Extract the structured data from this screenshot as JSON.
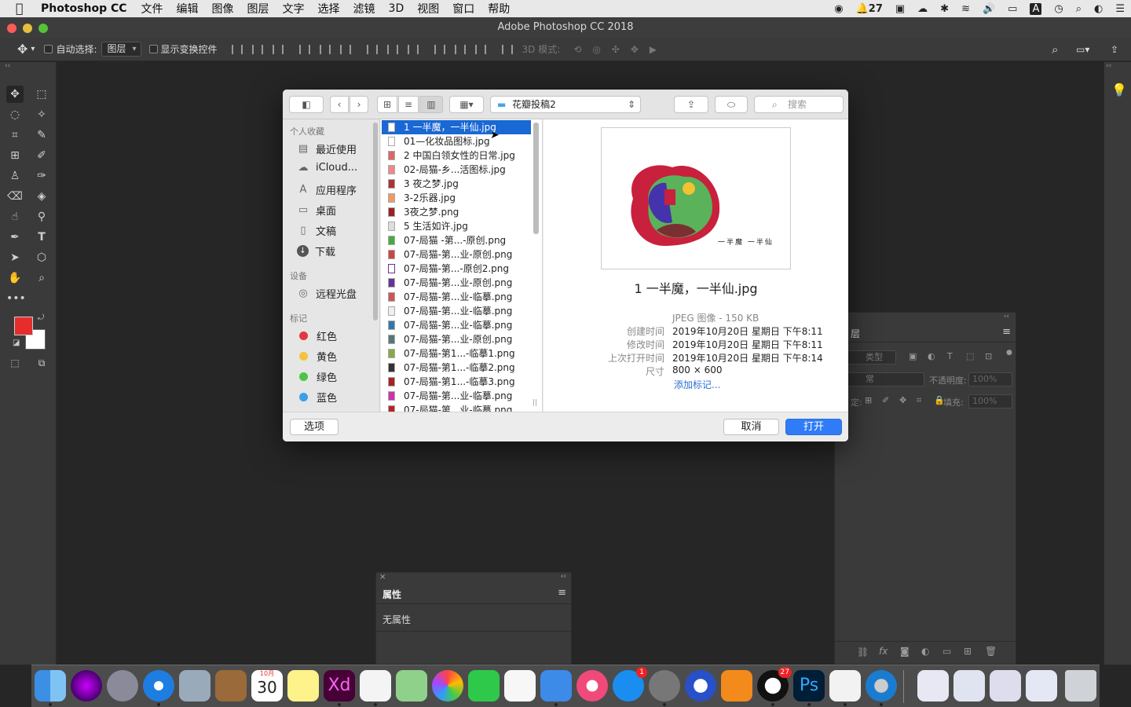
{
  "menubar": {
    "app_name": "Photoshop CC",
    "items": [
      "文件",
      "编辑",
      "图像",
      "图层",
      "文字",
      "选择",
      "滤镜",
      "3D",
      "视图",
      "窗口",
      "帮助"
    ],
    "notification_count": "27",
    "input_method": "A"
  },
  "window": {
    "title": "Adobe Photoshop CC 2018"
  },
  "options_bar": {
    "auto_select_label": "自动选择:",
    "auto_select_value": "图层",
    "show_transform_label": "显示变换控件",
    "mode_3d_label": "3D 模式:"
  },
  "dialog": {
    "location": "花瓣投稿2",
    "search_placeholder": "搜索",
    "sidebar": {
      "favorites_header": "个人收藏",
      "favorites": [
        "最近使用",
        "iCloud...",
        "应用程序",
        "桌面",
        "文稿",
        "下载"
      ],
      "devices_header": "设备",
      "devices": [
        "远程光盘"
      ],
      "tags_header": "标记",
      "tags": [
        {
          "label": "红色",
          "color": "#e3393b"
        },
        {
          "label": "黄色",
          "color": "#f3c33e"
        },
        {
          "label": "绿色",
          "color": "#4bc545"
        },
        {
          "label": "蓝色",
          "color": "#3b9ee8"
        }
      ]
    },
    "files": [
      "1 一半魔，一半仙.jpg",
      "01—化妆品图标.jpg",
      "2 中国白领女性的日常.jpg",
      "02-局猫-乡...活图标.jpg",
      "3 夜之梦.jpg",
      "3-2乐器.jpg",
      "3夜之梦.png",
      "5 生活如许.jpg",
      "07-局猫 -第...-原创.png",
      "07-局猫-第...业-原创.png",
      "07-局猫-第...-原创2.png",
      "07-局猫-第...业-原创.png",
      "07-局猫-第...业-临摹.png",
      "07-局猫-第...业-临摹.png",
      "07-局猫-第...业-临摹.png",
      "07-局猫-第...业-原创.png",
      "07-局猫-第1...-临摹1.png",
      "07-局猫-第1...-临摹2.png",
      "07-局猫-第1...-临摹3.png",
      "07-局猫-第...业-临摹.png",
      "07-局猫-第...业-临摹.png"
    ],
    "preview": {
      "filename": "1 一半魔，一半仙.jpg",
      "kind": "JPEG 图像 - 150 KB",
      "created_label": "创建时间",
      "created": "2019年10月20日 星期日 下午8:11",
      "modified_label": "修改时间",
      "modified": "2019年10月20日 星期日 下午8:11",
      "opened_label": "上次打开时间",
      "opened": "2019年10月20日 星期日 下午8:14",
      "size_label": "尺寸",
      "size": "800 × 600",
      "add_tags": "添加标记...",
      "artwork_caption": "一半魔 一半仙"
    },
    "options_button": "选项",
    "cancel_button": "取消",
    "open_button": "打开"
  },
  "layers_panel": {
    "tab": "层",
    "kind_label": "类型",
    "blend_mode": "常",
    "opacity_label": "不透明度:",
    "opacity_value": "100%",
    "lock_label": "定:",
    "fill_label": "填充:",
    "fill_value": "100%"
  },
  "properties_panel": {
    "title": "属性",
    "content": "无属性"
  },
  "dock": {
    "calendar_month": "10月",
    "calendar_day": "30",
    "appstore_badge": "1",
    "qq_badge": "27",
    "xd_label": "Xd",
    "ps_label": "Ps"
  },
  "colors": {
    "foreground": "#e62c2c",
    "background": "#ffffff",
    "selection": "#1968d4",
    "open_button": "#2f7cf6"
  }
}
